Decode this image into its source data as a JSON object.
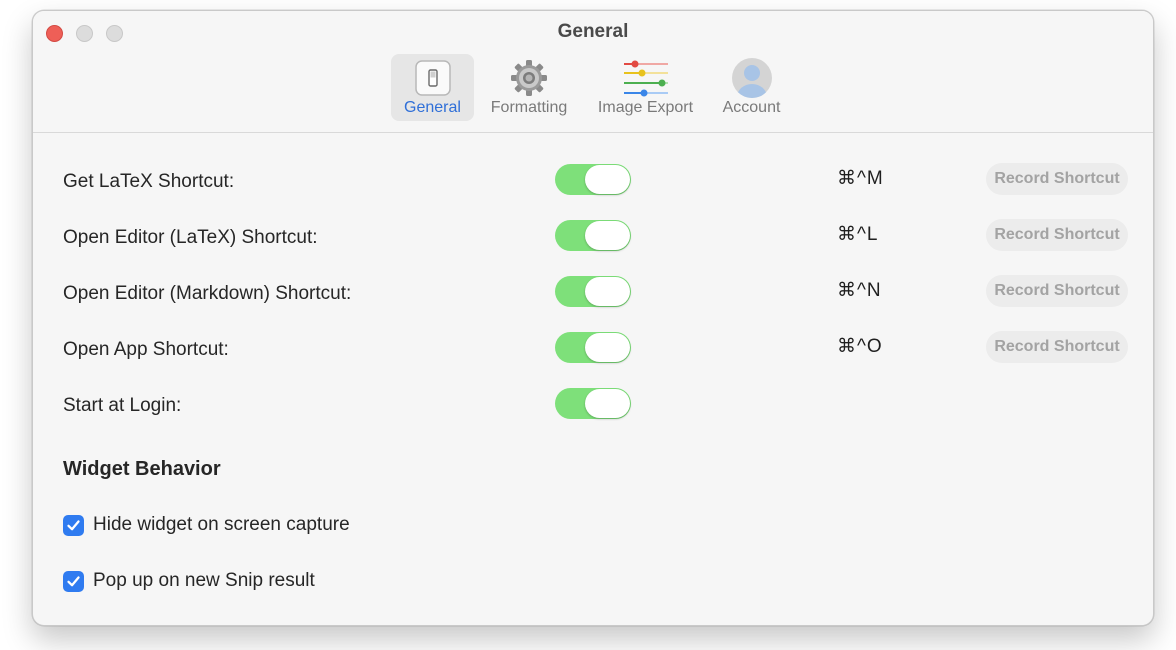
{
  "window": {
    "title": "General",
    "traffic_colors": {
      "close": "#ee5f57",
      "inactive": "#dcdcdc"
    }
  },
  "tabs": [
    {
      "label": "General",
      "icon": "switch-icon",
      "selected": true
    },
    {
      "label": "Formatting",
      "icon": "gear-icon",
      "selected": false
    },
    {
      "label": "Image Export",
      "icon": "sliders-icon",
      "selected": false
    },
    {
      "label": "Account",
      "icon": "user-avatar-icon",
      "selected": false
    }
  ],
  "settings": [
    {
      "label": "Get LaTeX Shortcut:",
      "enabled": true,
      "shortcut": "⌘^M",
      "button": "Record Shortcut"
    },
    {
      "label": "Open Editor (LaTeX) Shortcut:",
      "enabled": true,
      "shortcut": "⌘^L",
      "button": "Record Shortcut"
    },
    {
      "label": "Open Editor (Markdown) Shortcut:",
      "enabled": true,
      "shortcut": "⌘^N",
      "button": "Record Shortcut"
    },
    {
      "label": "Open App Shortcut:",
      "enabled": true,
      "shortcut": "⌘^O",
      "button": "Record Shortcut"
    },
    {
      "label": "Start at Login:",
      "enabled": true
    }
  ],
  "widget": {
    "title": "Widget Behavior",
    "options": [
      {
        "label": "Hide widget on screen capture",
        "checked": true
      },
      {
        "label": "Pop up on new Snip result",
        "checked": true
      }
    ]
  },
  "colors": {
    "toggle_on": "#7ee07a",
    "accent": "#2f7bf0",
    "tab_selected_text": "#2f6fd8"
  }
}
